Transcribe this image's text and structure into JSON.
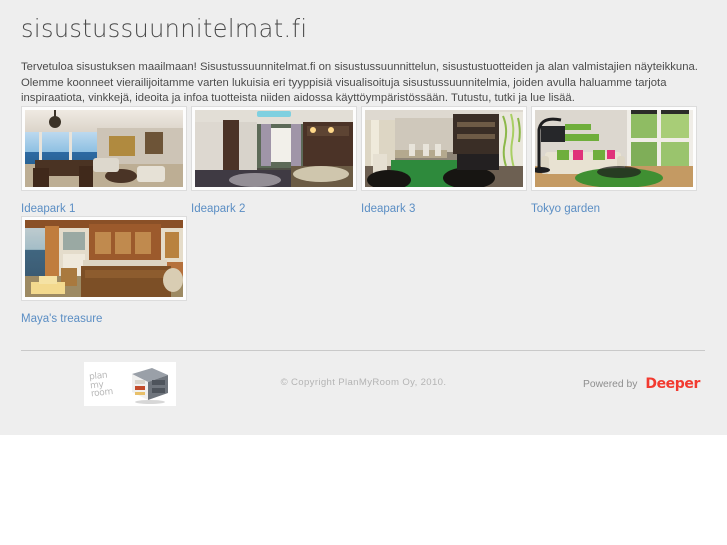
{
  "site": {
    "logo_text": "sisustussuunnitelmat.fi",
    "intro": "Tervetuloa sisustuksen maailmaan! Sisustussuunnitelmat.fi on sisustussuunnittelun, sisustustuotteiden ja alan valmistajien näyteikkuna. Olemme koonneet vierailijoitamme varten lukuisia eri tyyppisiä visualisoituja sisustussuunnitelmia, joiden avulla haluamme tarjota inspiraatiota, vinkkejä, ideoita ja infoa tuotteista niiden aidossa käyttöympäristössään. Tutustu, tutki ja lue lisää."
  },
  "colors": {
    "page_background": "#eeeeee",
    "link": "#5b8ec4",
    "text": "#4c4c4c",
    "logo": "#4a4a4a",
    "divider": "#c9c9c9",
    "brand_accent": "#f23a30",
    "footer_text": "#b4b4b4"
  },
  "gallery": {
    "items": [
      {
        "label": "Ideapark 1",
        "alt": "living-room-with-sea-view"
      },
      {
        "label": "Ideapark 2",
        "alt": "bedroom-purple-green"
      },
      {
        "label": "Ideapark 3",
        "alt": "dining-room-green-rug"
      },
      {
        "label": "Tokyo garden",
        "alt": "living-room-green-accents"
      },
      {
        "label": "Maya's treasure",
        "alt": "terracotta-bedroom-sea-view"
      }
    ]
  },
  "footer": {
    "copyright": "© Copyright PlanMyRoom Oy, 2010.",
    "powered_by_label": "Powered by",
    "powered_by_brand": "Deeper",
    "logo_line1": "plan",
    "logo_line2": "my",
    "logo_line3": "room"
  }
}
